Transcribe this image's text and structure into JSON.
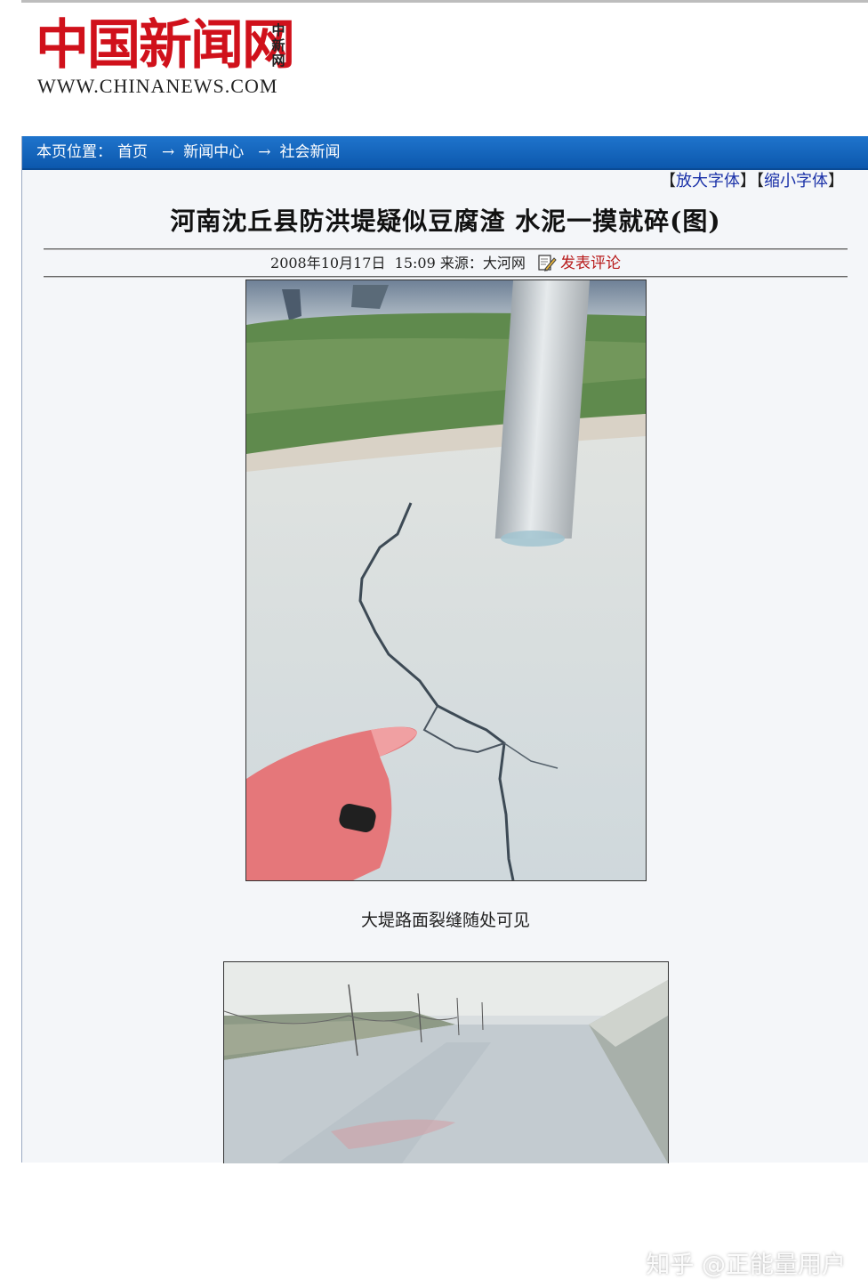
{
  "logo": {
    "chinese": "中国新闻网",
    "side_text": "中新网",
    "english": "WWW.CHINANEWS.COM"
  },
  "breadcrumb": {
    "prefix": "本页位置：",
    "items": [
      "首页",
      "新闻中心",
      "社会新闻"
    ],
    "arrow": "→"
  },
  "font_tools": {
    "enlarge": "放大字体",
    "shrink": "缩小字体"
  },
  "article": {
    "title": "河南沈丘县防洪堤疑似豆腐渣  水泥一摸就碎(图)",
    "date": "2008年10月17日",
    "time": "15:09",
    "source_label": "来源：",
    "source": "大河网",
    "comment_link": "发表评论",
    "photo1_caption": "大堤路面裂缝随处可见"
  },
  "watermark": "知乎 @正能量用户",
  "colors": {
    "logo_red": "#d0111b",
    "nav_blue": "#0c58ad",
    "link_blue": "#1a31a8",
    "comment_red": "#b81b1b"
  }
}
